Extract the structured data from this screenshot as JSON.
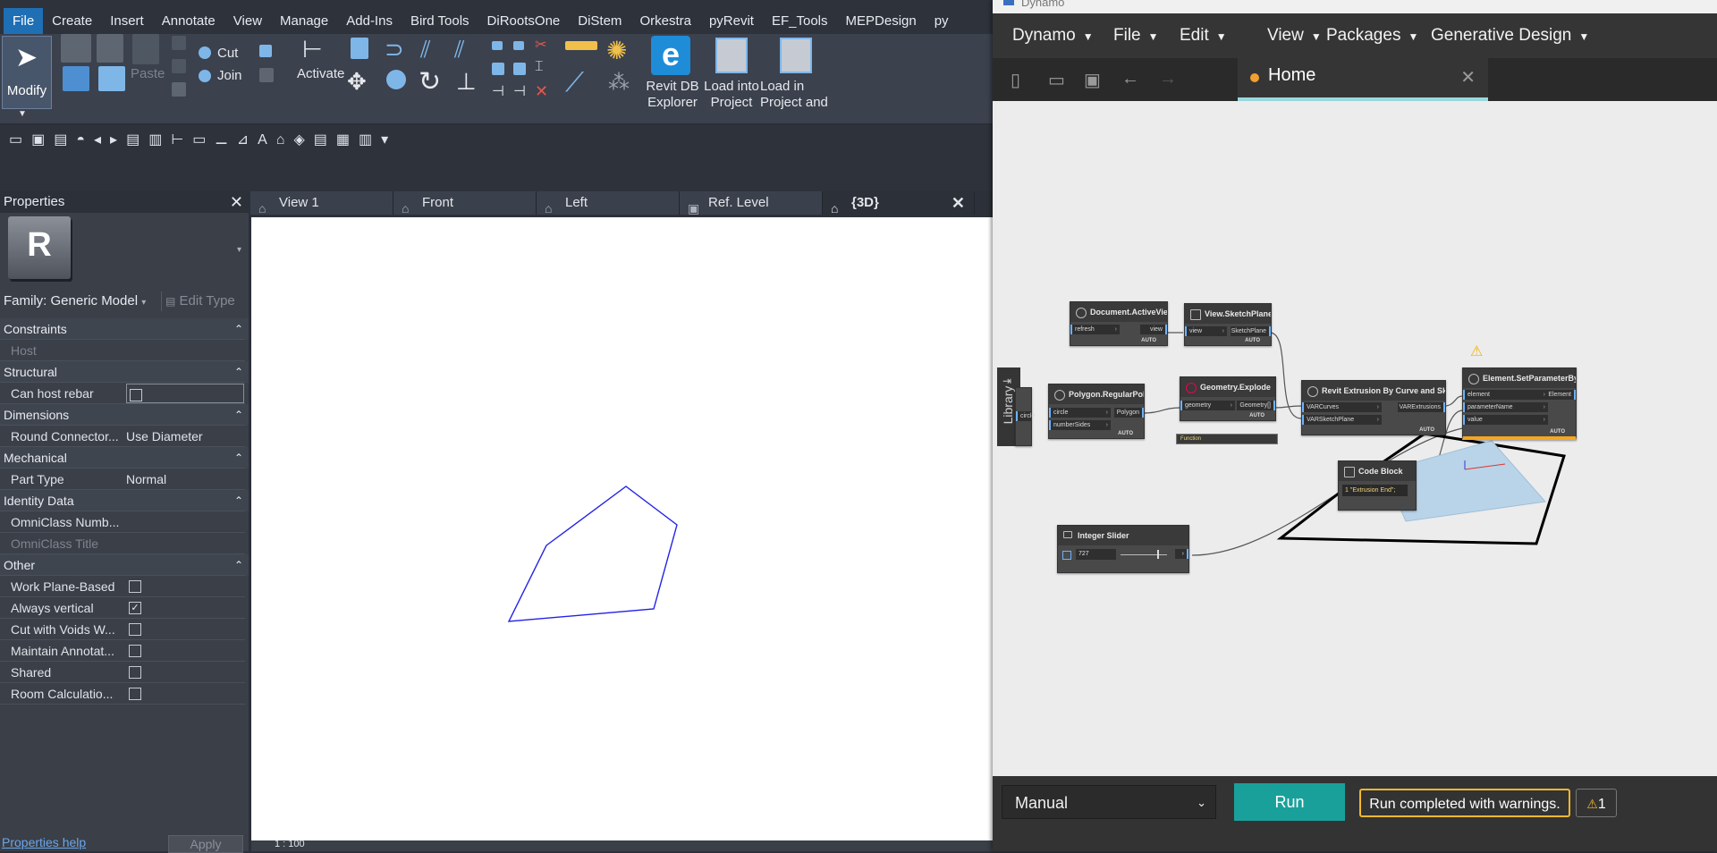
{
  "revit": {
    "menu": [
      "File",
      "Create",
      "Insert",
      "Annotate",
      "View",
      "Manage",
      "Add-Ins",
      "Bird Tools",
      "DiRootsOne",
      "DiStem",
      "Orkestra",
      "pyRevit",
      "EF_Tools",
      "MEPDesign",
      "py"
    ],
    "ribbon": {
      "modify": "Modify",
      "paste": "Paste",
      "cut": "Cut",
      "join": "Join",
      "activate": "Activate",
      "revit_db_explorer_1": "Revit DB",
      "revit_db_explorer_2": "Explorer",
      "load_project_1": "Load into",
      "load_project_2": "Project",
      "load_project_close_1": "Load in",
      "load_project_close_2": "Project and"
    },
    "properties": {
      "title": "Properties",
      "family_select": "Family: Generic Model",
      "edit_type": "Edit Type",
      "rows": [
        {
          "type": "cat",
          "label": "Constraints"
        },
        {
          "type": "prop",
          "label": "Host",
          "value": "",
          "dim": true
        },
        {
          "type": "cat",
          "label": "Structural"
        },
        {
          "type": "check",
          "label": "Can host rebar",
          "checked": false
        },
        {
          "type": "cat",
          "label": "Dimensions"
        },
        {
          "type": "prop",
          "label": "Round Connector...",
          "value": "Use Diameter"
        },
        {
          "type": "cat",
          "label": "Mechanical"
        },
        {
          "type": "prop",
          "label": "Part Type",
          "value": "Normal"
        },
        {
          "type": "cat",
          "label": "Identity Data"
        },
        {
          "type": "prop",
          "label": "OmniClass Numb...",
          "value": ""
        },
        {
          "type": "prop",
          "label": "OmniClass Title",
          "value": "",
          "dim": true
        },
        {
          "type": "cat",
          "label": "Other"
        },
        {
          "type": "check",
          "label": "Work Plane-Based",
          "checked": false
        },
        {
          "type": "check",
          "label": "Always vertical",
          "checked": true
        },
        {
          "type": "check",
          "label": "Cut with Voids W...",
          "checked": false
        },
        {
          "type": "check",
          "label": "Maintain Annotat...",
          "checked": false
        },
        {
          "type": "check",
          "label": "Shared",
          "checked": false
        },
        {
          "type": "check",
          "label": "Room Calculatio...",
          "checked": false
        }
      ],
      "help_link": "Properties help",
      "apply": "Apply"
    },
    "view_tabs": [
      "View 1",
      "Front",
      "Left",
      "Ref. Level",
      "{3D}"
    ],
    "view_scale": "1 : 100",
    "polygon_color": "#2323e6"
  },
  "dynamo": {
    "title": "Dynamo",
    "menu": [
      "Dynamo",
      "File",
      "Edit",
      "View",
      "Packages",
      "Generative Design"
    ],
    "tab": "Home",
    "library": "Library",
    "nodes": {
      "active_view": {
        "title": "Document.ActiveView",
        "in": [
          "refresh"
        ],
        "out": [
          "view"
        ],
        "lacing": "AUTO"
      },
      "sketch_plane": {
        "title": "View.SketchPlane",
        "in": [
          "view"
        ],
        "out": [
          "SketchPlane"
        ],
        "lacing": "AUTO"
      },
      "regular_polygon": {
        "title": "Polygon.RegularPolygon",
        "in": [
          "circle",
          "numberSides"
        ],
        "out": [
          "Polygon"
        ],
        "lacing": "AUTO"
      },
      "explode": {
        "title": "Geometry.Explode",
        "in": [
          "geometry"
        ],
        "out": [
          "Geometry[]"
        ],
        "lacing": "AUTO",
        "function": "Function"
      },
      "extrusion": {
        "title": "Revit Extrusion By Curve and Sketchplane",
        "in": [
          "VARCurves",
          "VARSketchPlane"
        ],
        "out": [
          "VARExtrusions"
        ],
        "lacing": "AUTO"
      },
      "set_param": {
        "title": "Element.SetParameterByName",
        "in": [
          "element",
          "parameterName",
          "value"
        ],
        "out": [
          "Element"
        ],
        "lacing": "AUTO"
      },
      "code_block": {
        "title": "Code Block",
        "code": "1 \"Extrusion End\";"
      },
      "slider": {
        "title": "Integer Slider",
        "value": "727"
      },
      "partial_left": {
        "in": [
          "circle"
        ],
        "lacing": "AUTO"
      }
    },
    "run_mode": "Manual",
    "run_button": "Run",
    "status": "Run completed with warnings.",
    "warning_count": "1",
    "accent": "#1aa09a",
    "warning_color": "#f2b830"
  }
}
